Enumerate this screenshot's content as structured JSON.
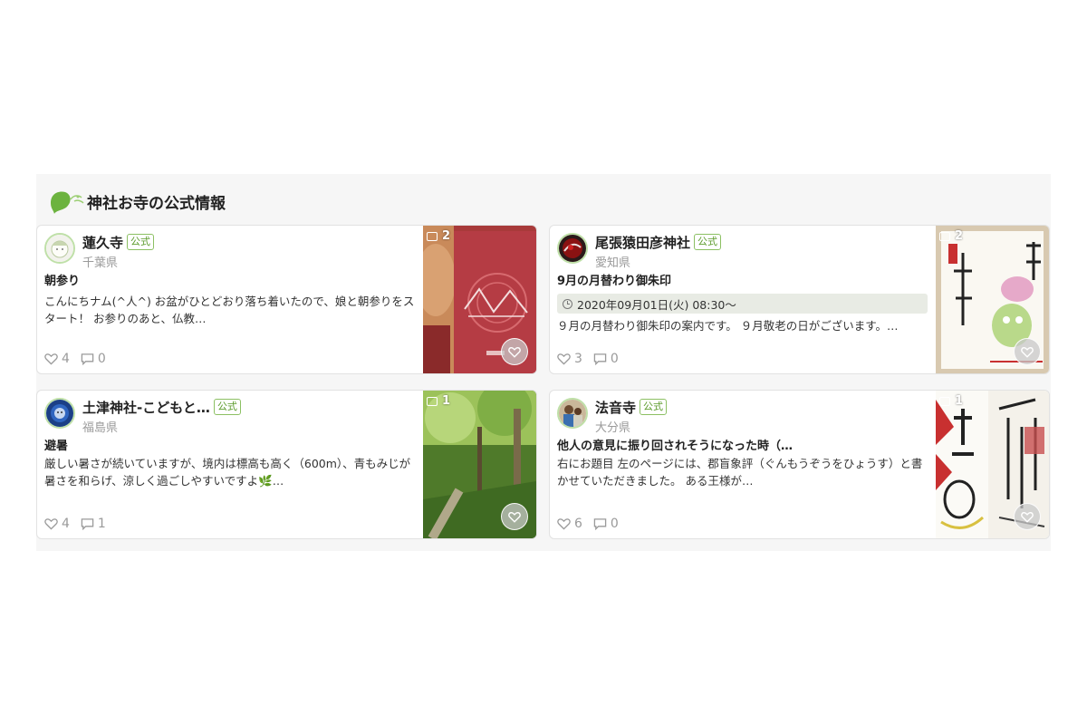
{
  "section": {
    "title": "神社お寺の公式情報"
  },
  "cards": [
    {
      "shrine_name": "蓮久寺",
      "official_label": "公式",
      "prefecture": "千葉県",
      "post_title": "朝参り",
      "post_text": "こんにちナム(^人^) お盆がひとどおり落ち着いたので、娘と朝参りをスタート！ お参りのあと、仏教…",
      "likes": "4",
      "comments": "0",
      "photo_count": "2"
    },
    {
      "shrine_name": "尾張猿田彦神社",
      "official_label": "公式",
      "prefecture": "愛知県",
      "post_title": "9月の月替わり御朱印",
      "event_datetime": "2020年09月01日(火) 08:30〜",
      "post_text": "９月の月替わり御朱印の案内です。 ９月敬老の日がございます。…",
      "likes": "3",
      "comments": "0",
      "photo_count": "2"
    },
    {
      "shrine_name": "土津神社-こどもと…",
      "official_label": "公式",
      "prefecture": "福島県",
      "post_title": "避暑",
      "post_text": "厳しい暑さが続いていますが、境内は標高も高く（600m）、青もみじが暑さを和らげ、涼しく過ごしやすいですよ🌿…",
      "likes": "4",
      "comments": "1",
      "photo_count": "1"
    },
    {
      "shrine_name": "法音寺",
      "official_label": "公式",
      "prefecture": "大分県",
      "post_title": "他人の意見に振り回されそうになった時（…",
      "post_text": "右にお題目 左のページには、郡盲象評（ぐんもうぞうをひょうす）と書かせていただきました。 ある王様が…",
      "likes": "6",
      "comments": "0",
      "photo_count": "1"
    }
  ],
  "colors": {
    "accent_green": "#6cb33f",
    "badge_border": "#8cc063",
    "muted_text": "#9a9a9a"
  }
}
